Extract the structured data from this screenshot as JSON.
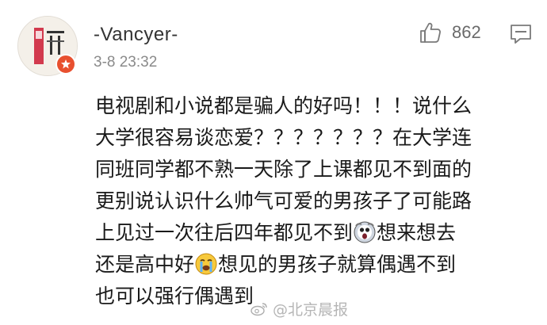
{
  "comment": {
    "username": "-Vancyer-",
    "timestamp": "3-8 23:32",
    "like_count": "862",
    "lines": [
      "电视剧和小说都是骗人的好吗！！！说什么",
      "大学很容易谈恋爱？？？？？？？在大学连",
      "同班同学都不熟一天除了上课都见不到面的",
      "更别说认识什么帅气可爱的男孩子了可能路",
      "上见过一次往后四年都见不到",
      "想来想去",
      "还是高中好",
      "想见的男孩子就算偶遇不到",
      "也可以强行偶遇到"
    ],
    "emojis": [
      "scream-emoji",
      "crying-emoji"
    ]
  },
  "watermark": {
    "text": "@北京晨报",
    "icon": "weibo-icon"
  },
  "colors": {
    "text": "#1a1a1a",
    "username": "#333333",
    "meta": "#8a8a8a",
    "badge": "#e8502f"
  }
}
